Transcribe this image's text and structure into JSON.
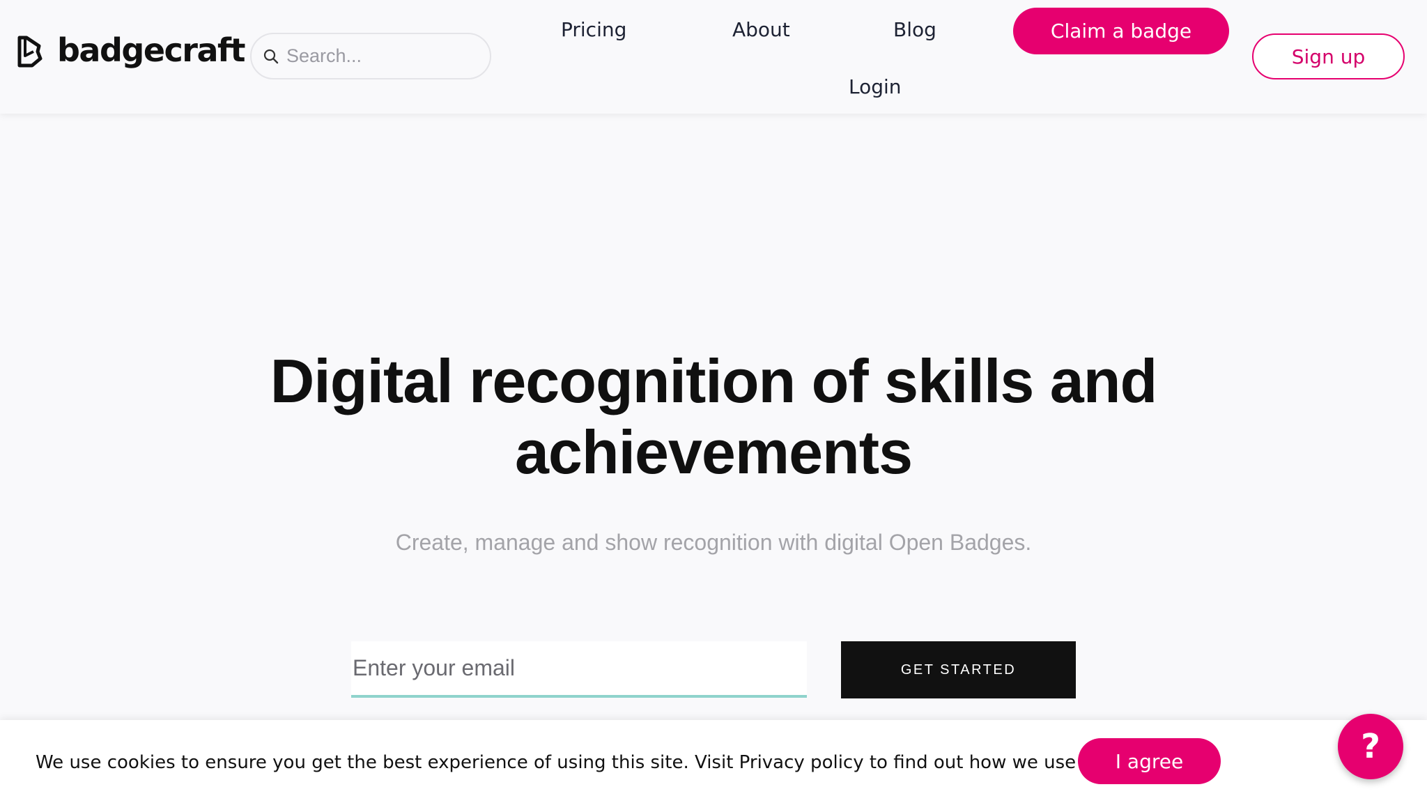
{
  "header": {
    "logo": {
      "text": "badgecraft",
      "icon": "badgecraft-logo-icon"
    },
    "search": {
      "placeholder": "Search...",
      "value": "",
      "icon": "search-icon"
    },
    "nav": {
      "pricing": "Pricing",
      "about": "About",
      "blog": "Blog",
      "login": "Login"
    },
    "claim_badge_label": "Claim a badge",
    "sign_up_label": "Sign up"
  },
  "hero": {
    "title_line1": "Digital recognition of skills and",
    "title_line2": "achievements",
    "subtitle": "Create, manage and show recognition with digital Open Badges.",
    "email_placeholder": "Enter your email",
    "email_value": "",
    "cta_label": "GET STARTED"
  },
  "cookie": {
    "message": "We use cookies to ensure you get the best experience of using this site. Visit Privacy policy to find out how we use cookies.",
    "agree_label": "I agree"
  },
  "help": {
    "glyph": "?",
    "icon": "help-question-icon"
  },
  "colors": {
    "accent": "#e6006f",
    "background": "#f9f9fb",
    "text_dark": "#101010",
    "subtitle_gray": "#a3a3a8",
    "input_underline": "#8fd3cc",
    "cta_background": "#111111"
  }
}
